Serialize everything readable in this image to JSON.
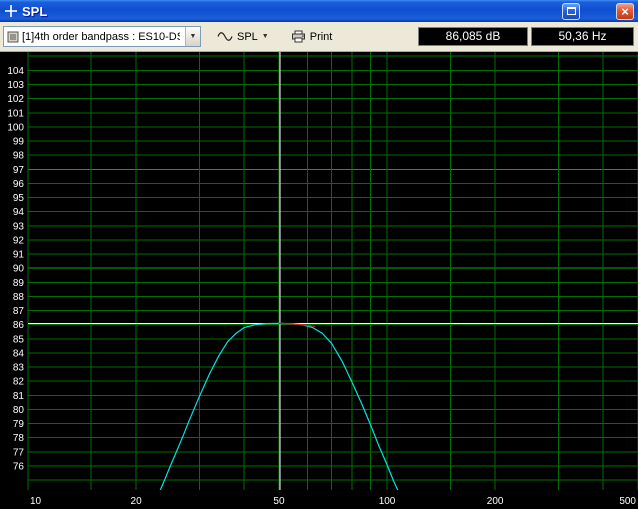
{
  "window": {
    "title": "SPL"
  },
  "toolbar": {
    "driver_select_value": "[1]4th order bandpass : ES10-DS",
    "graph_type_label": "SPL",
    "print_label": "Print",
    "spl_readout": "86,085 dB",
    "frequency_readout": "50,36 Hz"
  },
  "icons": {
    "close": "×",
    "dropdown": "▼"
  },
  "colors": {
    "plot_bg": "#000000",
    "grid": "#007000",
    "grid_bright": "#00b000",
    "crosshair": "#ffffff",
    "curve": "#00e5e5",
    "marker": "#cc2222",
    "tick_text": "#ffffff"
  },
  "chart_data": {
    "type": "line",
    "title": "",
    "xlabel": "",
    "ylabel": "",
    "x_scale": "log",
    "x_range": [
      10,
      500
    ],
    "x_tick_labels": [
      10,
      20,
      50,
      100,
      200,
      500
    ],
    "x_gridlines": [
      10,
      15,
      20,
      30,
      40,
      50,
      60,
      70,
      80,
      90,
      100,
      150,
      200,
      300,
      400,
      500
    ],
    "y_axis": {
      "top_value": 105.3,
      "bottom_value": 74.3
    },
    "y_gridlines": {
      "from": 75,
      "to": 105,
      "step": 1
    },
    "y_bright_gridlines": [
      90,
      97
    ],
    "y_tick_labels": [
      104,
      103,
      102,
      101,
      100,
      99,
      98,
      97,
      96,
      95,
      94,
      93,
      92,
      91,
      90,
      89,
      88,
      87,
      86,
      85,
      84,
      83,
      82,
      81,
      80,
      79,
      78,
      77,
      76
    ],
    "cursor": {
      "frequency_hz": 50.36,
      "spl_db": 86.085
    },
    "series": [
      {
        "name": "spl-response",
        "color": "#00e5e5",
        "points": [
          [
            23,
            73.9
          ],
          [
            24,
            75.0
          ],
          [
            25,
            76.1
          ],
          [
            26,
            77.1
          ],
          [
            27,
            78.1
          ],
          [
            28,
            79.1
          ],
          [
            30,
            80.9
          ],
          [
            32,
            82.5
          ],
          [
            34,
            83.8
          ],
          [
            36,
            84.8
          ],
          [
            38,
            85.4
          ],
          [
            40,
            85.8
          ],
          [
            43,
            86.0
          ],
          [
            46,
            86.08
          ],
          [
            50,
            86.09
          ],
          [
            54,
            86.08
          ],
          [
            58,
            86.0
          ],
          [
            62,
            85.8
          ],
          [
            66,
            85.4
          ],
          [
            70,
            84.7
          ],
          [
            75,
            83.4
          ],
          [
            80,
            81.9
          ],
          [
            85,
            80.4
          ],
          [
            90,
            78.9
          ],
          [
            95,
            77.4
          ],
          [
            100,
            76.1
          ],
          [
            104,
            75.0
          ],
          [
            108,
            74.1
          ]
        ]
      },
      {
        "name": "peak-marker",
        "color": "#cc2222",
        "points": [
          [
            50,
            86.09
          ],
          [
            55,
            86.05
          ],
          [
            60,
            85.95
          ],
          [
            63,
            85.88
          ]
        ]
      }
    ]
  }
}
